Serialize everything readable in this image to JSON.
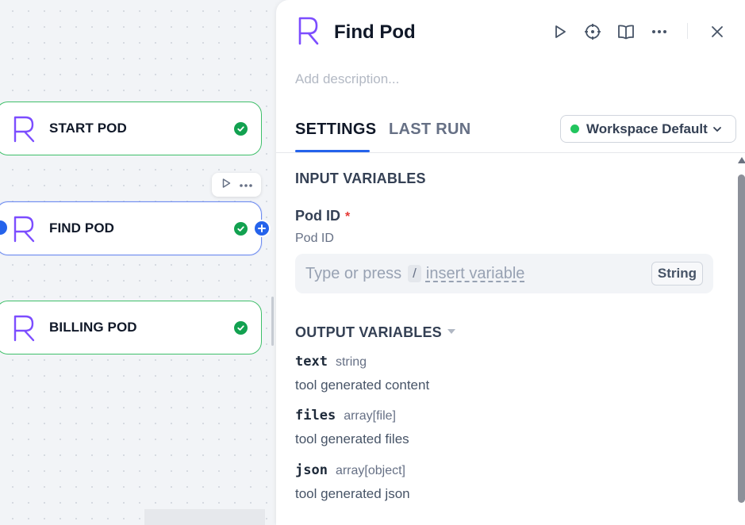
{
  "canvas": {
    "nodes": [
      {
        "title": "START POD",
        "status": "success"
      },
      {
        "title": "FIND POD",
        "status": "success",
        "selected": true
      },
      {
        "title": "BILLING POD",
        "status": "success"
      }
    ],
    "toolbar": {
      "run_icon": "play-icon",
      "more_icon": "more-icon"
    }
  },
  "panel": {
    "title": "Find Pod",
    "description_placeholder": "Add description...",
    "header_icons": [
      "play-icon",
      "crosshair-icon",
      "book-icon",
      "more-icon",
      "close-icon"
    ],
    "tabs": [
      {
        "label": "SETTINGS",
        "active": true
      },
      {
        "label": "LAST RUN",
        "active": false
      }
    ],
    "environment": {
      "label": "Workspace Default",
      "status_color": "#22c55e"
    },
    "input_section": {
      "heading": "INPUT VARIABLES",
      "field": {
        "label": "Pod ID",
        "required_mark": "*",
        "description": "Pod ID",
        "placeholder_prefix": "Type or press",
        "placeholder_key": "/",
        "placeholder_link": "insert variable",
        "type": "String"
      }
    },
    "output_section": {
      "heading": "OUTPUT VARIABLES",
      "items": [
        {
          "name": "text",
          "type": "string",
          "description": "tool generated content"
        },
        {
          "name": "files",
          "type": "array[file]",
          "description": "tool generated files"
        },
        {
          "name": "json",
          "type": "array[object]",
          "description": "tool generated json"
        }
      ]
    }
  },
  "colors": {
    "accent": "#2563eb",
    "brand_purple": "#7c4dff",
    "success": "#12a150",
    "node_border": "#3fbf6a",
    "selected_border": "#6e8cf0"
  }
}
